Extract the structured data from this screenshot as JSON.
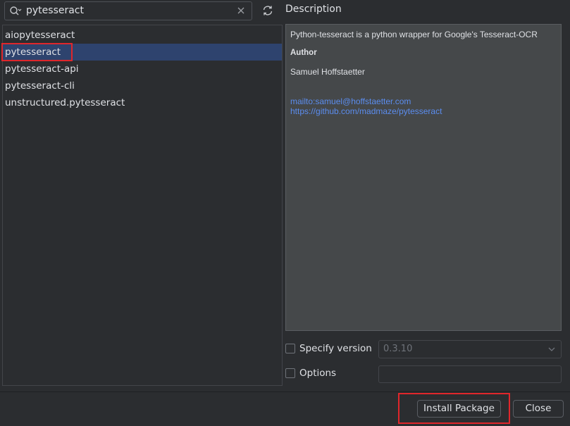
{
  "search": {
    "value": "pytesseract"
  },
  "packages": [
    {
      "name": "aiopytesseract",
      "selected": false
    },
    {
      "name": "pytesseract",
      "selected": true
    },
    {
      "name": "pytesseract-api",
      "selected": false
    },
    {
      "name": "pytesseract-cli",
      "selected": false
    },
    {
      "name": "unstructured.pytesseract",
      "selected": false
    }
  ],
  "description": {
    "heading": "Description",
    "summary": "Python-tesseract is a python wrapper for Google's Tesseract-OCR",
    "author_label": "Author",
    "author_name": "Samuel Hoffstaetter",
    "email_link": "mailto:samuel@hoffstaetter.com",
    "repo_link": "https://github.com/madmaze/pytesseract"
  },
  "options": {
    "specify_version_label": "Specify version",
    "specify_version_checked": false,
    "version_value": "0.3.10",
    "options_label": "Options",
    "options_checked": false,
    "options_value": ""
  },
  "buttons": {
    "install_label": "Install Package",
    "close_label": "Close"
  },
  "colors": {
    "selection": "#2e436e",
    "link": "#5b8def",
    "highlight_box": "#e0262b"
  }
}
